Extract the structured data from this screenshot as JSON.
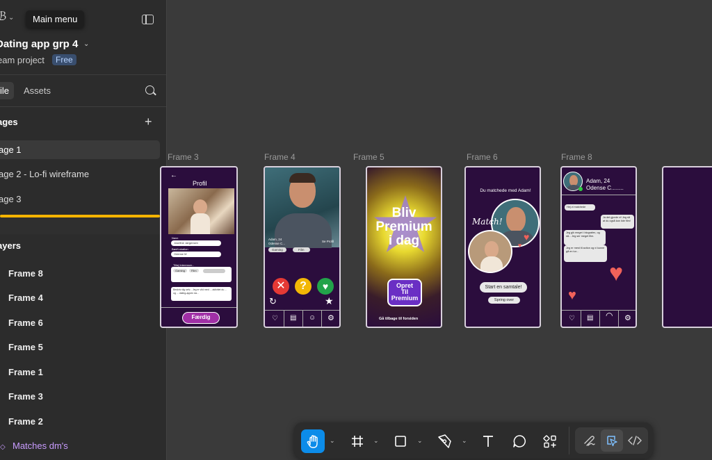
{
  "app": {
    "logo_glyph": "ℬ",
    "tooltip": "Main menu",
    "project_name": "Dating app grp 4",
    "team": "eam project",
    "plan_badge": "Free"
  },
  "tabs": {
    "file": "ile",
    "assets": "Assets"
  },
  "pages": {
    "title": "ages",
    "items": [
      {
        "label": "age 1",
        "selected": true
      },
      {
        "label": "age 2 - Lo-fi wireframe",
        "selected": false
      },
      {
        "label": "age 3",
        "selected": false
      }
    ]
  },
  "layers": {
    "title": "ayers",
    "items": [
      {
        "label": "Frame 8",
        "type": "frame"
      },
      {
        "label": "Frame 4",
        "type": "frame"
      },
      {
        "label": "Frame 6",
        "type": "frame"
      },
      {
        "label": "Frame 5",
        "type": "frame"
      },
      {
        "label": "Frame 1",
        "type": "frame"
      },
      {
        "label": "Frame 3",
        "type": "frame"
      },
      {
        "label": "Frame 2",
        "type": "frame"
      },
      {
        "label": "Matches dm's",
        "type": "component"
      }
    ]
  },
  "canvas": {
    "frame_labels": [
      "Frame 3",
      "Frame 4",
      "Frame 5",
      "Frame 6",
      "Frame 8"
    ],
    "frame3": {
      "title": "Profil",
      "field_name_label": "Navn",
      "field_name_value": "Josefine Jørgensen",
      "field_city_label": "Bød/Lokation",
      "field_city_value": "Odense M",
      "interests_label": "Tilføj interesser...",
      "chips": [
        "Gaming",
        "Film"
      ],
      "about_text": "Beskriv dig selv... Jeg er vild med ... aktivitet du ... og ... dating-appen da...",
      "done_button": "Færdig"
    },
    "frame4": {
      "name_line": "Adam, 24",
      "city_line": "Odense C...",
      "see_profile": "Se Profil",
      "chips": [
        "Gaming",
        "Film"
      ]
    },
    "frame5": {
      "headline": [
        "Bliv",
        "Premium",
        "i dag"
      ],
      "cta": [
        "Opret",
        "Til",
        "Premium"
      ],
      "back_text": "Gå tilbage til forsiden"
    },
    "frame6": {
      "title": "Du matchede med Adam!",
      "match_word": "Match!",
      "start_chat": "Start en samtale!",
      "skip": "Spring over"
    },
    "frame8": {
      "name_line": "Adam, 24",
      "city_line": "Odense C........",
      "bubble1": "Hej vi matchede",
      "bubble2": "Ja det gjorde vi! Jeg så at du også kan lide film!",
      "bubble3": "Jeg gik meget i biografen, og så... Jeg ser meget film.",
      "bubble4": "Jeg er mest til action og vi kunne gå en tur..."
    }
  },
  "toolbar": {
    "tools": [
      "hand-tool",
      "frame-tool",
      "rectangle-tool",
      "pen-tool",
      "text-tool",
      "comment-tool",
      "components-tool"
    ],
    "modes": [
      "draw-mode",
      "design-mode",
      "dev-mode"
    ],
    "active_tool": "hand-tool",
    "active_mode": "design-mode",
    "accent": "#0c8ce9"
  },
  "colors": {
    "canvas_bg": "#3a3a3a",
    "sidebar_bg": "#2c2c2c",
    "frame_bg": "#2b0d3d",
    "accent_yellow": "#f5b400",
    "component_purple": "#c99cff"
  }
}
